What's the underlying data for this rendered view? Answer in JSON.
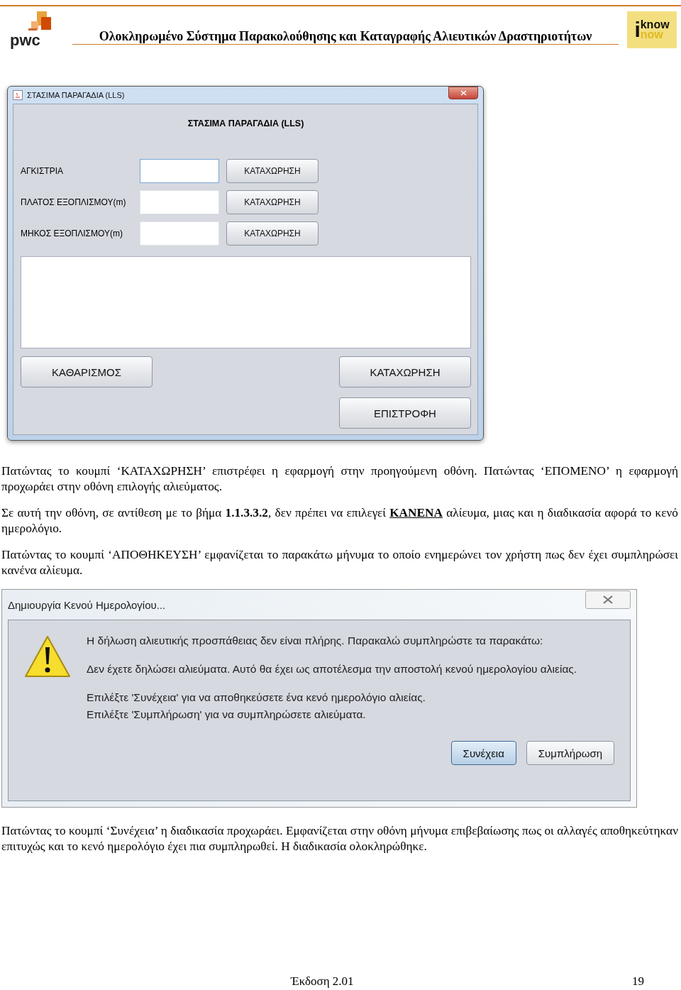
{
  "header": {
    "title": "Ολοκληρωμένο Σύστημα Παρακολούθησης και Καταγραφής Αλιευτικών Δραστηριοτήτων",
    "left_logo": {
      "text": "pwc"
    },
    "right_logo": {
      "letter": "i",
      "word": "know",
      "word2": "now"
    }
  },
  "form_window": {
    "title": "ΣΤΑΣΙΜΑ ΠΑΡΑΓΑΔΙΑ (LLS)",
    "heading": "ΣΤΑΣΙΜΑ ΠΑΡΑΓΑΔΙΑ (LLS)",
    "fields": [
      {
        "label": "ΑΓΚΙΣΤΡΙΑ",
        "button": "ΚΑΤΑΧΩΡΗΣΗ",
        "focused": true
      },
      {
        "label": "ΠΛΑΤΟΣ ΕΞΟΠΛΙΣΜΟΥ(m)",
        "button": "ΚΑΤΑΧΩΡΗΣΗ",
        "focused": false
      },
      {
        "label": "ΜΗΚΟΣ ΕΞΟΠΛΙΣΜΟΥ(m)",
        "button": "ΚΑΤΑΧΩΡΗΣΗ",
        "focused": false
      }
    ],
    "clear_button": "ΚΑΘΑΡΙΣΜΟΣ",
    "save_button": "ΚΑΤΑΧΩΡΗΣΗ",
    "back_button": "ΕΠΙΣΤΡΟΦΗ"
  },
  "paragraphs_1": [
    "Πατώντας το κουμπί ‘ΚΑΤΑΧΩΡΗΣΗ’ επιστρέφει η εφαρμογή στην προηγούμενη οθόνη. Πατώντας ‘ΕΠΟΜΕΝΟ’ η εφαρμογή προχωράει στην οθόνη επιλογής αλιεύματος.",
    "Σε αυτή την οθόνη, σε αντίθεση με το βήμα **1.1.3.3.2**, δεν πρέπει να επιλεγεί **ΚΑΝΕΝΑ** αλίευμα, μιας και η διαδικασία αφορά το κενό ημερολόγιο.",
    "Πατώντας το κουμπί ‘ΑΠΟΘΗΚΕΥΣΗ’ εμφανίζεται το παρακάτω μήνυμα το οποίο ενημερώνει τον χρήστη πως δεν έχει συμπληρώσει κανένα αλίευμα."
  ],
  "dialog": {
    "title": "Δημιουργία Κενού Ημερολογίου...",
    "message_groups": [
      [
        "Η δήλωση αλιευτικής προσπάθειας δεν είναι πλήρης. Παρακαλώ συμπληρώστε τα παρακάτω:"
      ],
      [
        "Δεν έχετε δηλώσει αλιεύματα. Αυτό θα έχει ως αποτέλεσμα την αποστολή κενού ημερολογίου αλιείας."
      ],
      [
        "Επιλέξτε 'Συνέχεια' για να αποθηκεύσετε ένα κενό ημερολόγιο αλιείας.",
        "Επιλέξτε 'Συμπλήρωση' για να συμπληρώσετε αλιεύματα."
      ]
    ],
    "buttons": [
      {
        "label": "Συνέχεια",
        "selected": true
      },
      {
        "label": "Συμπλήρωση",
        "selected": false
      }
    ]
  },
  "paragraphs_2": [
    "Πατώντας το κουμπί ‘Συνέχεια’ η διαδικασία προχωράει. Εμφανίζεται στην οθόνη μήνυμα επιβεβαίωσης πως οι αλλαγές αποθηκεύτηκαν επιτυχώς και το κενό ημερολόγιο έχει πια συμπληρωθεί. Η διαδικασία ολοκληρώθηκε."
  ],
  "footer": {
    "version": "Έκδοση 2.01",
    "page": "19"
  }
}
